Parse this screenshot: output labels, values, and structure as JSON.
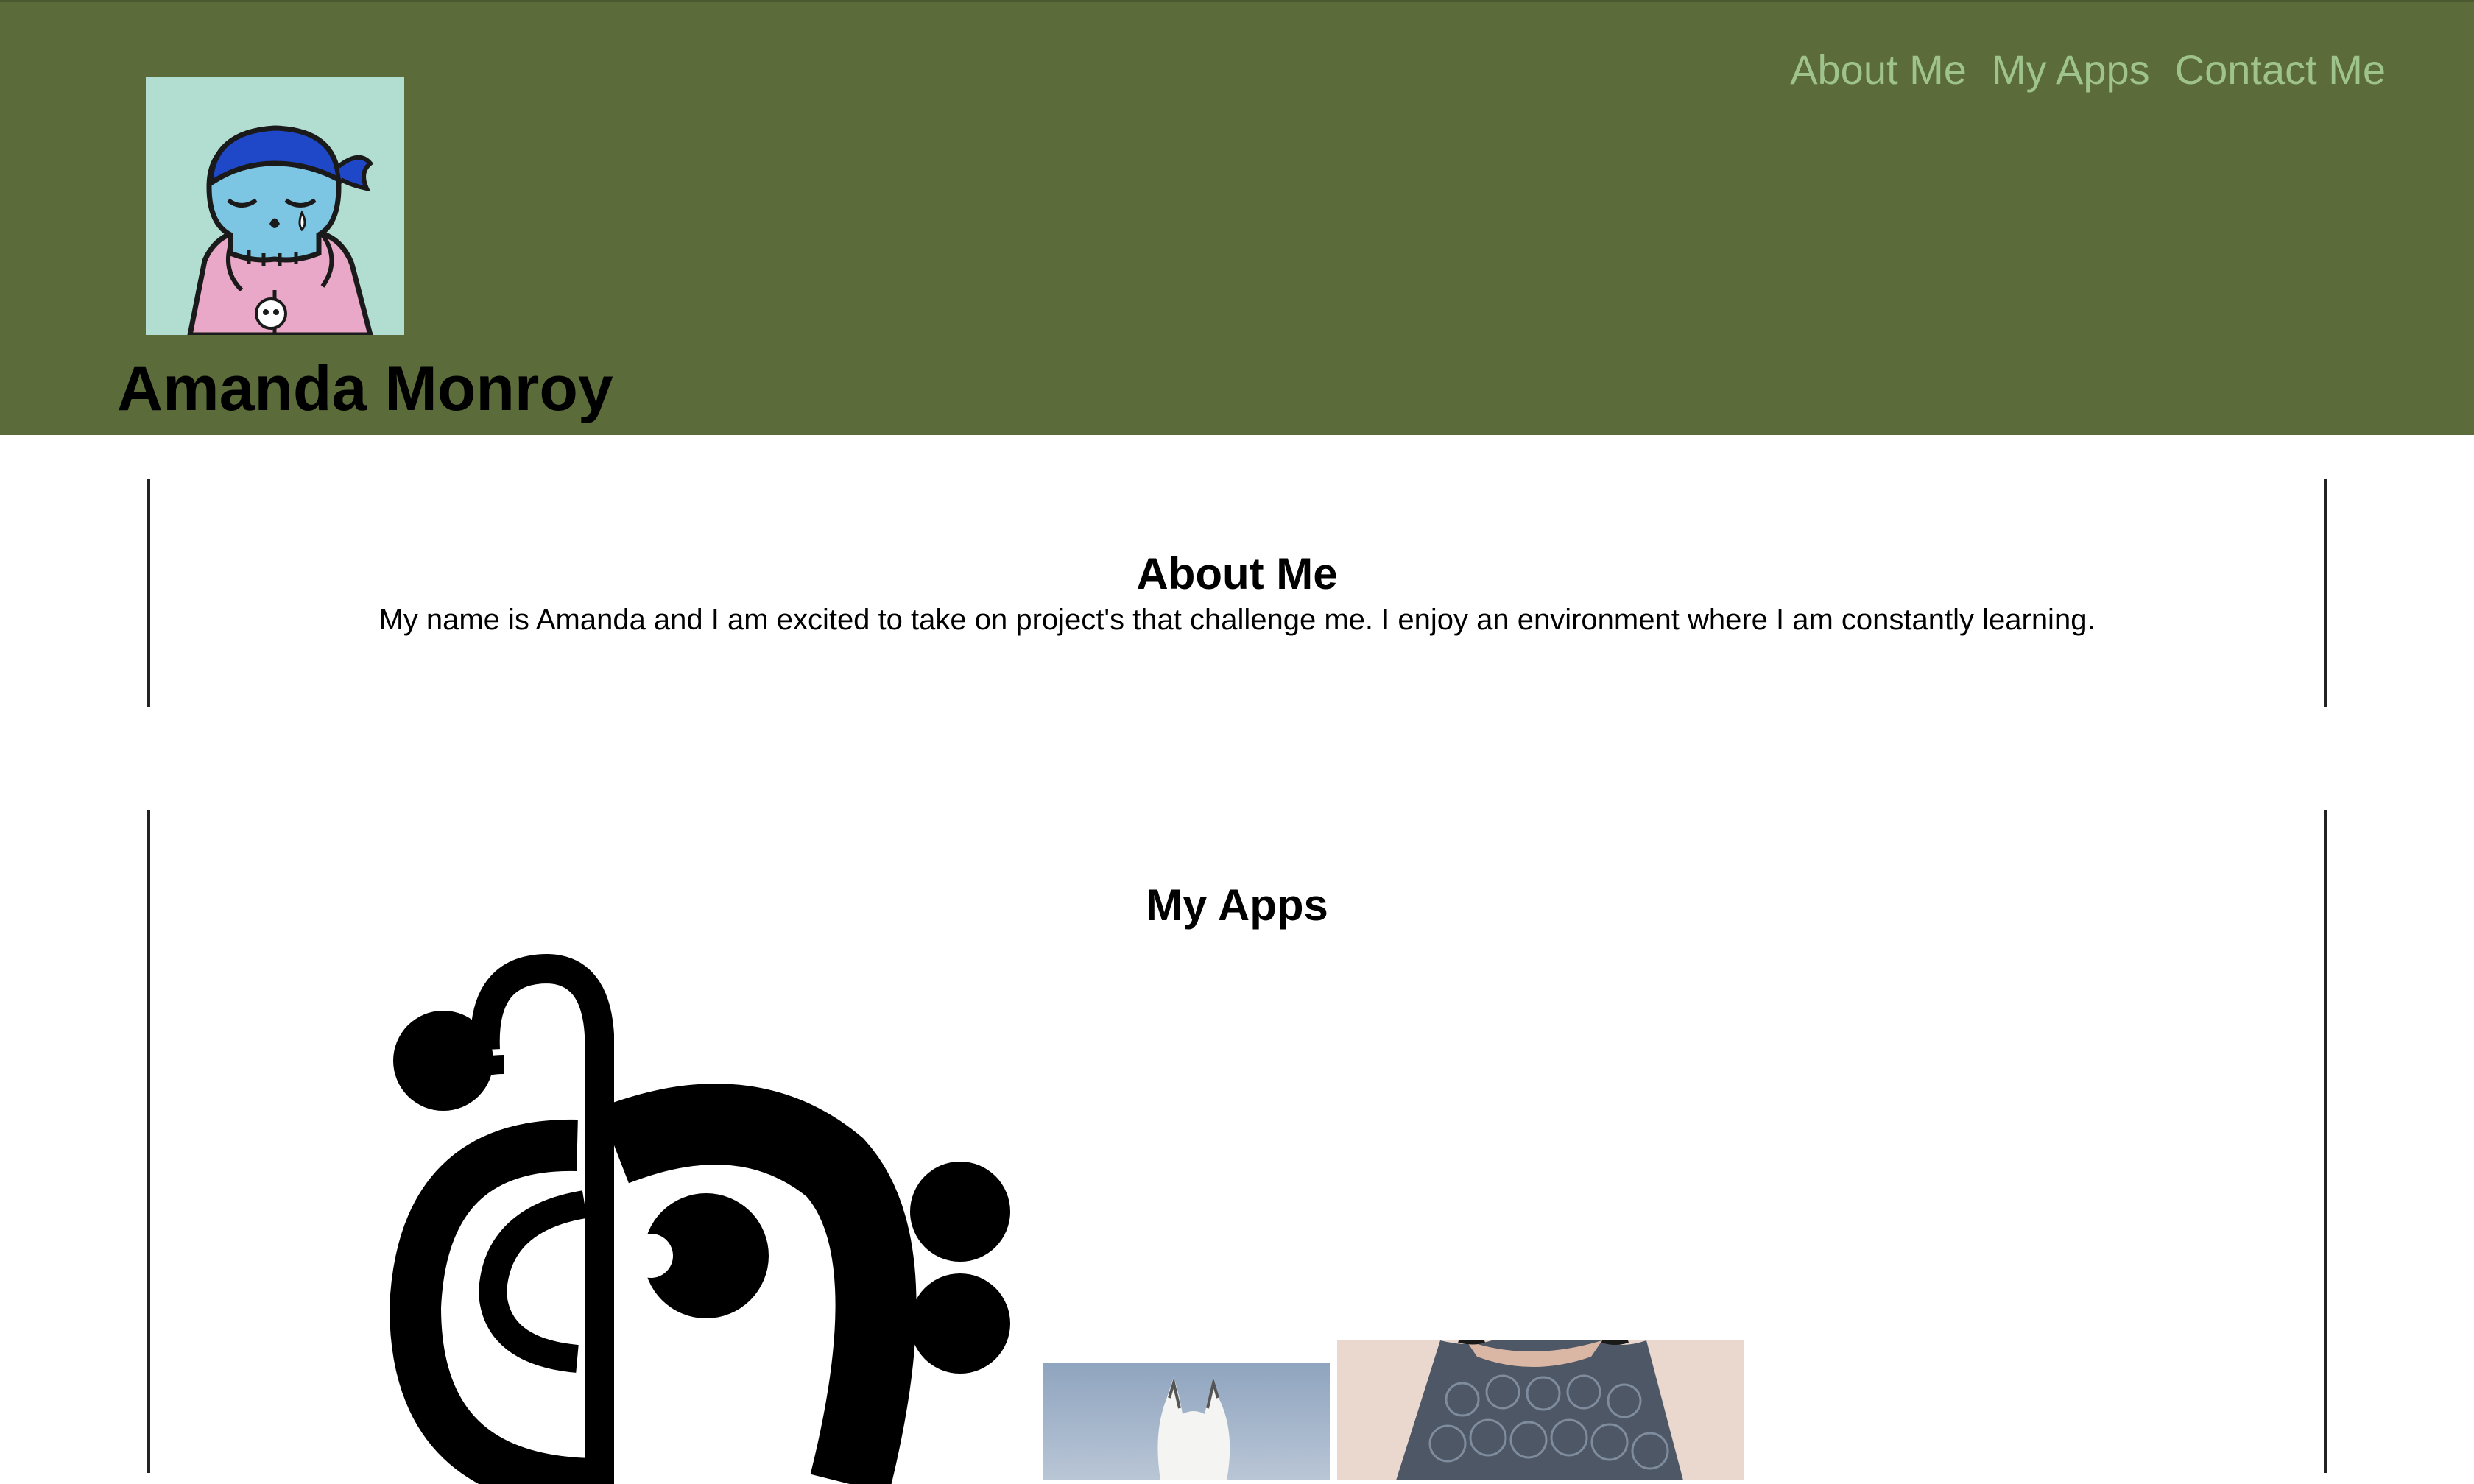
{
  "header": {
    "site_title": "Amanda Monroy",
    "avatar_icon": "skull-bandana-avatar-icon",
    "background_color": "#5b6b39",
    "nav": [
      {
        "label": "About Me"
      },
      {
        "label": "My Apps"
      },
      {
        "label": "Contact Me"
      }
    ],
    "nav_color": "#9fc38c"
  },
  "about": {
    "heading": "About Me",
    "text": "My name is Amanda and I am excited to take on project's that challenge me. I enjoy an environment where I am constantly learning."
  },
  "apps": {
    "heading": "My Apps",
    "items": [
      {
        "icon": "music-clef-icon"
      },
      {
        "icon": "llama-photo"
      },
      {
        "icon": "crochet-top-photo"
      }
    ]
  }
}
